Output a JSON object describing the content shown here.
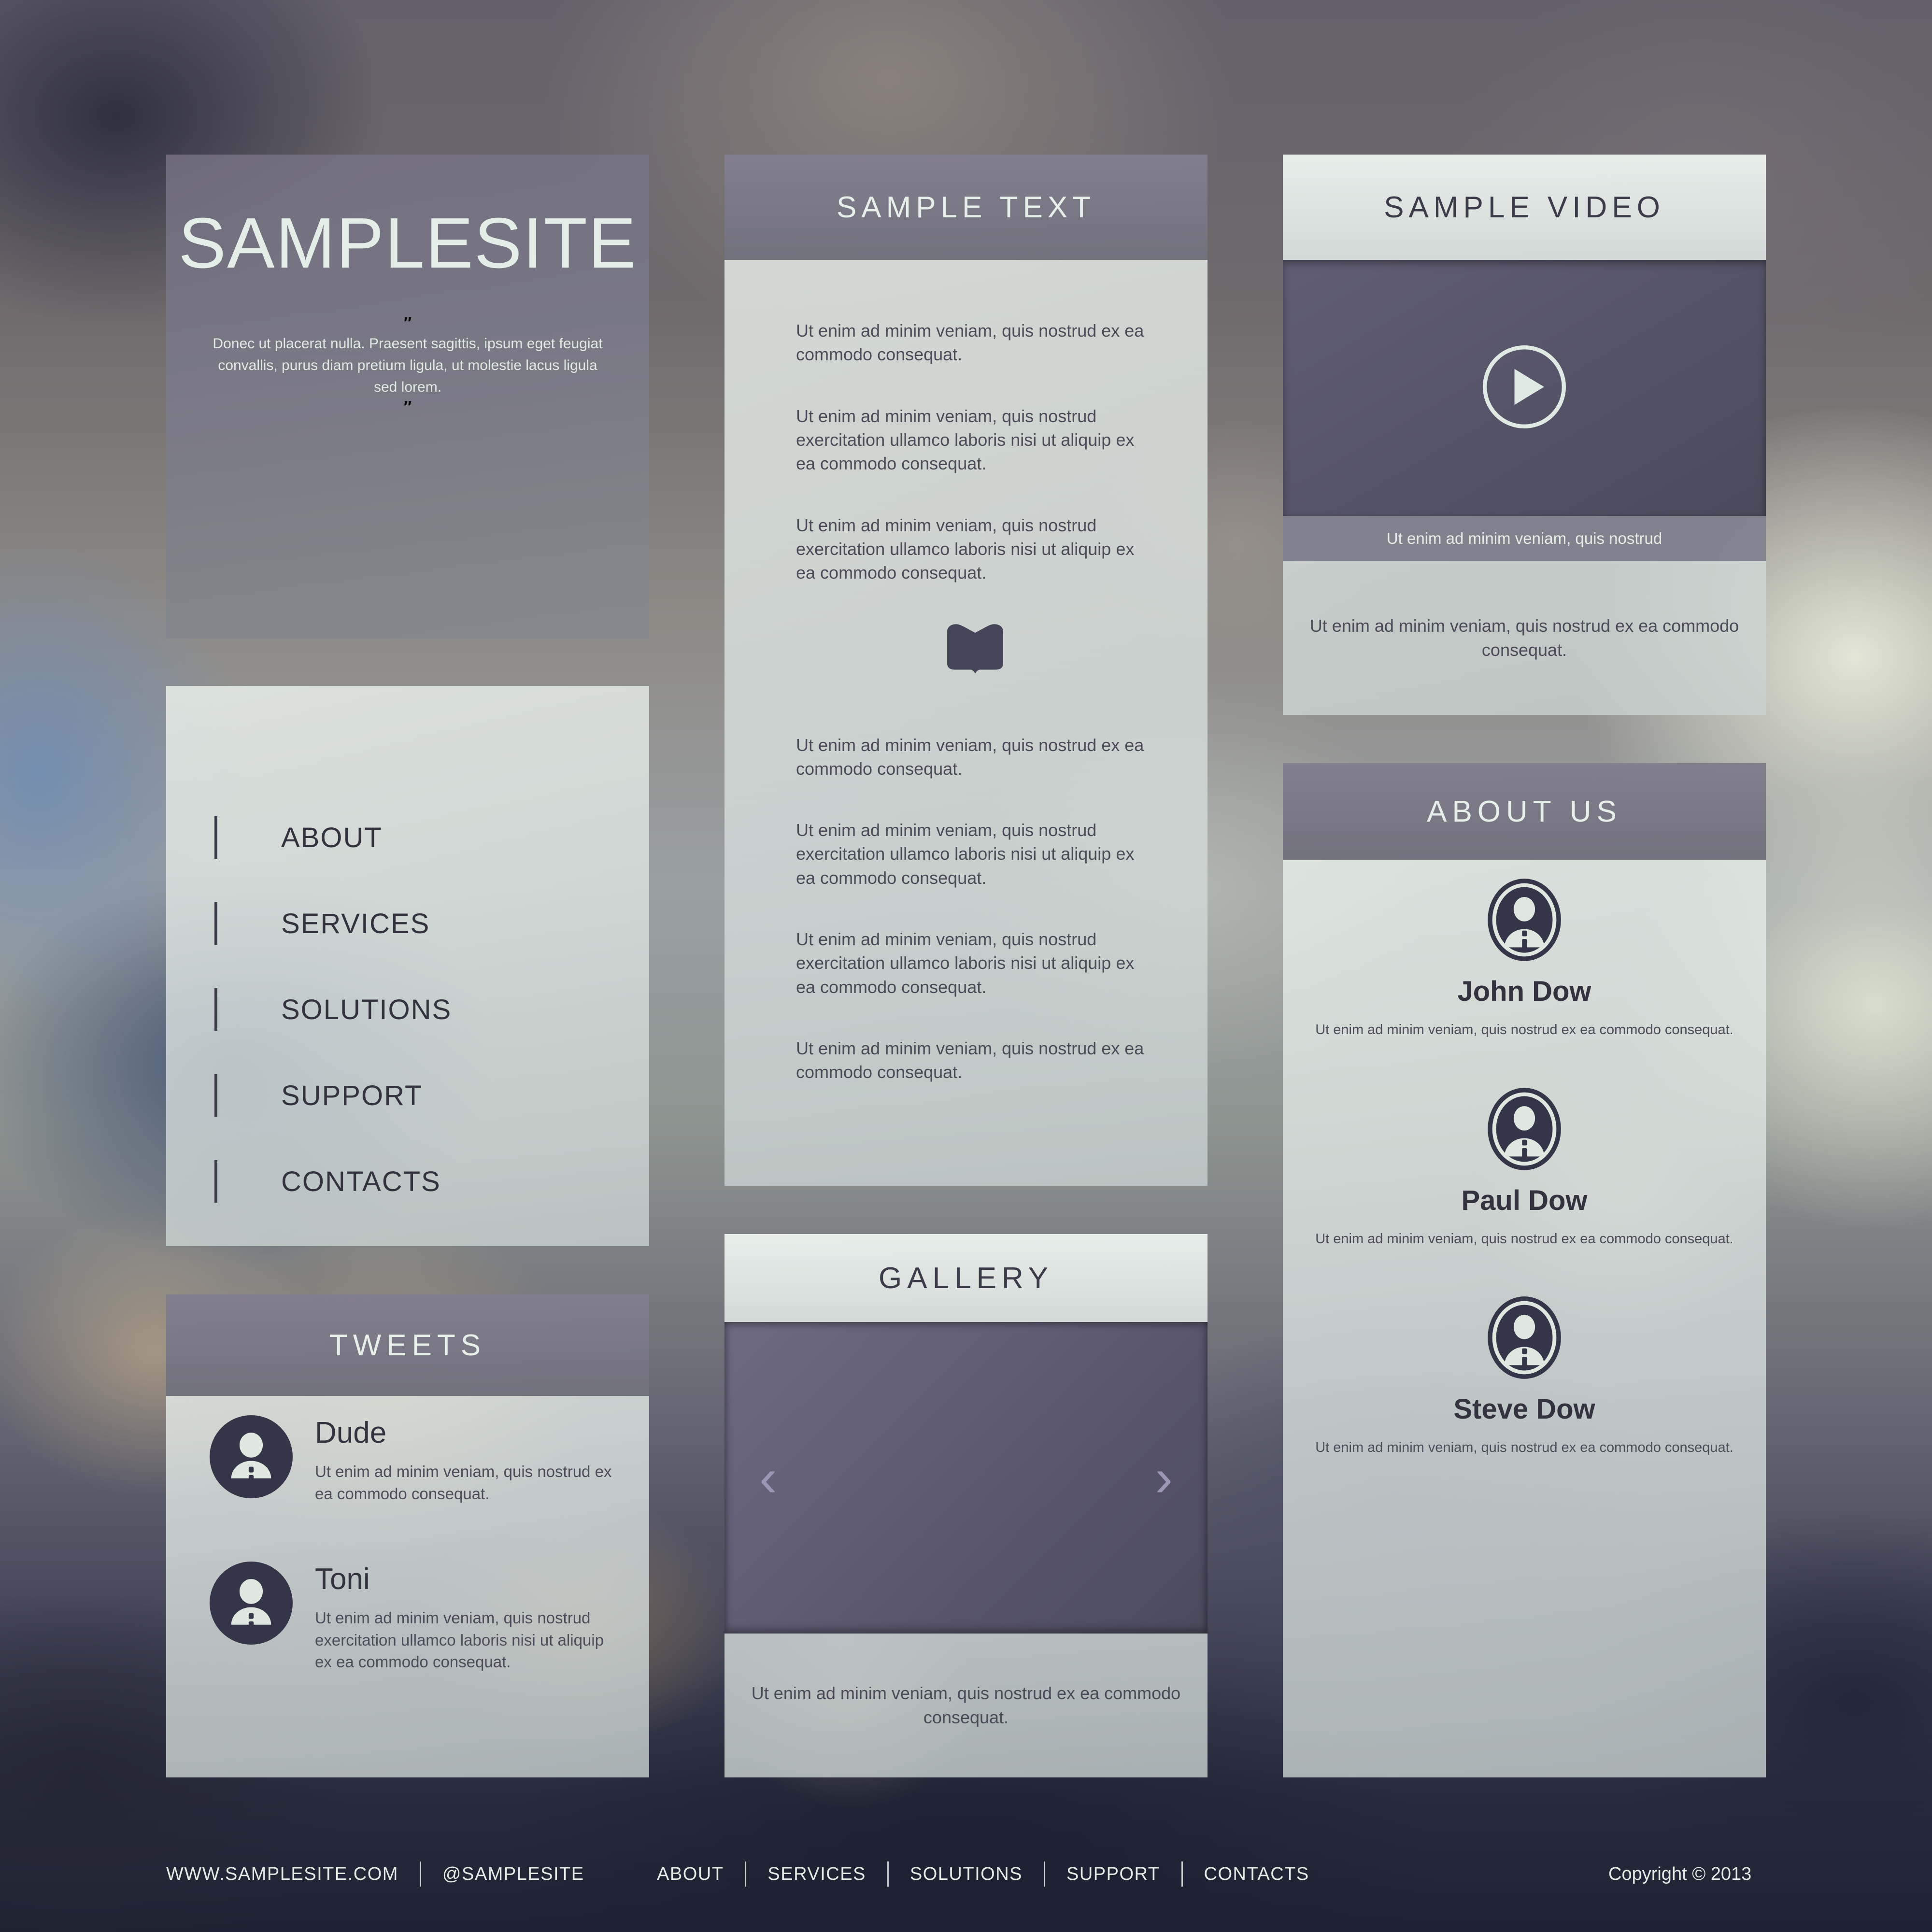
{
  "header": {
    "title": "SAMPLESITE",
    "quote_open": "″",
    "quote_close": "″",
    "tagline": "Donec ut placerat nulla. Praesent sagittis, ipsum eget feugiat convallis, purus diam pretium ligula, ut molestie lacus ligula sed lorem."
  },
  "nav": {
    "items": [
      {
        "label": "ABOUT"
      },
      {
        "label": "SERVICES"
      },
      {
        "label": "SOLUTIONS"
      },
      {
        "label": "SUPPORT"
      },
      {
        "label": "CONTACTS"
      }
    ]
  },
  "tweets": {
    "title": "TWEETS",
    "items": [
      {
        "name": "Dude",
        "text": "Ut enim ad minim veniam, quis nostrud ex ea commodo consequat."
      },
      {
        "name": "Toni",
        "text": "Ut enim ad minim veniam, quis nostrud exercitation ullamco laboris nisi ut aliquip ex ea commodo consequat."
      }
    ]
  },
  "sample_text": {
    "title": "SAMPLE TEXT",
    "paragraphs_top": [
      "Ut enim ad minim veniam, quis nostrud ex ea commodo consequat.",
      "Ut enim ad minim veniam, quis nostrud exercitation ullamco laboris nisi ut aliquip ex ea commodo consequat.",
      "Ut enim ad minim veniam, quis nostrud exercitation ullamco laboris nisi ut aliquip ex ea commodo consequat."
    ],
    "divider_icon": "book-icon",
    "paragraphs_bottom": [
      "Ut enim ad minim veniam, quis nostrud ex ea commodo consequat.",
      "Ut enim ad minim veniam, quis nostrud exercitation ullamco laboris nisi ut aliquip ex ea commodo consequat.",
      "Ut enim ad minim veniam, quis nostrud exercitation ullamco laboris nisi ut aliquip ex ea commodo consequat.",
      "Ut enim ad minim veniam, quis nostrud ex ea commodo consequat."
    ]
  },
  "gallery": {
    "title": "GALLERY",
    "prev_icon": "chevron-left-icon",
    "next_icon": "chevron-right-icon",
    "prev_glyph": "‹",
    "next_glyph": "›",
    "caption": "Ut enim ad minim veniam, quis nostrud ex ea commodo consequat."
  },
  "video": {
    "title": "SAMPLE VIDEO",
    "play_icon": "play-button-icon",
    "overlay_caption": "Ut enim ad minim veniam, quis nostrud",
    "caption": "Ut enim ad minim veniam, quis nostrud ex ea commodo consequat."
  },
  "about_us": {
    "title": "ABOUT US",
    "members": [
      {
        "name": "John Dow",
        "text": "Ut enim ad minim veniam, quis nostrud ex ea commodo consequat."
      },
      {
        "name": "Paul Dow",
        "text": "Ut enim ad minim veniam, quis nostrud ex ea commodo consequat."
      },
      {
        "name": "Steve Dow",
        "text": "Ut enim ad minim veniam, quis nostrud ex ea commodo consequat."
      }
    ]
  },
  "footer": {
    "website": "WWW.SAMPLESITE.COM",
    "twitter": "@SAMPLESITE",
    "links": [
      {
        "label": "ABOUT"
      },
      {
        "label": "SERVICES"
      },
      {
        "label": "SOLUTIONS"
      },
      {
        "label": "SUPPORT"
      },
      {
        "label": "CONTACTS"
      }
    ],
    "copyright": "Copyright © 2013"
  },
  "colors": {
    "panel_light": "#e4eae6",
    "panel_dark": "#7a7a88",
    "bar_dark": "#6e6e7a",
    "text_dark": "#33333f",
    "text_light": "#e6efe9",
    "media_dark": "#5a5870",
    "arrow": "#9b97b4"
  }
}
